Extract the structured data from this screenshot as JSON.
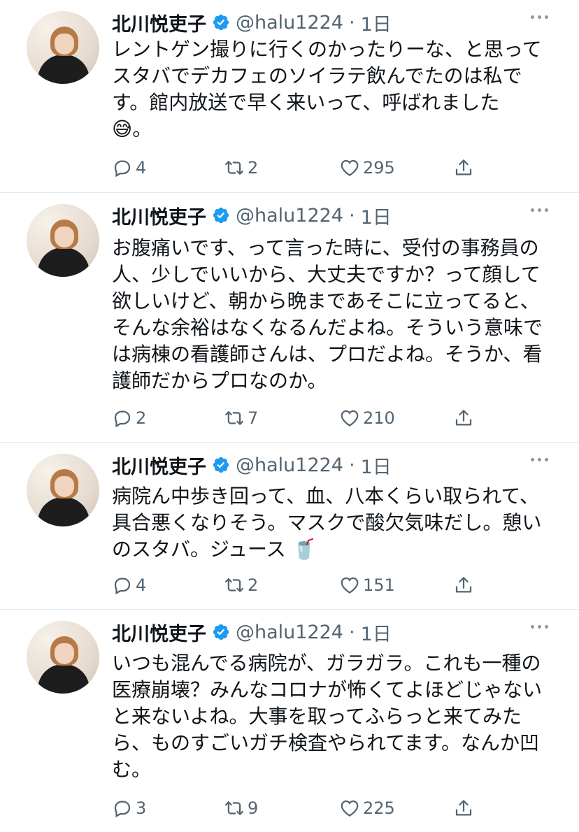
{
  "tweets": [
    {
      "name": "北川悦吏子",
      "handle": "@halu1224",
      "dot": "·",
      "time": "1日",
      "text": "レントゲン撮りに行くのかったりーな、と思って\nスタバでデカフェのソイラテ飲んでたのは私で\nす。館内放送で早く来いって、呼ばれました\n😅。",
      "replies": "4",
      "retweets": "2",
      "likes": "295"
    },
    {
      "name": "北川悦吏子",
      "handle": "@halu1224",
      "dot": "·",
      "time": "1日",
      "text": "お腹痛いです、って言った時に、受付の事務員の\n人、少しでいいから、大丈夫ですか？って顔して\n欲しいけど、朝から晩まであそこに立ってると、\nそんな余裕はなくなるんだよね。そういう意味で\nは病棟の看護師さんは、プロだよね。そうか、看\n護師だからプロなのか。",
      "replies": "2",
      "retweets": "7",
      "likes": "210"
    },
    {
      "name": "北川悦吏子",
      "handle": "@halu1224",
      "dot": "·",
      "time": "1日",
      "text": "病院ん中歩き回って、血、八本くらい取られて、\n具合悪くなりそう。マスクで酸欠気味だし。憩い\nのスタバ。ジュース 🥤",
      "replies": "4",
      "retweets": "2",
      "likes": "151"
    },
    {
      "name": "北川悦吏子",
      "handle": "@halu1224",
      "dot": "·",
      "time": "1日",
      "text": "いつも混んでる病院が、ガラガラ。これも一種の\n医療崩壊？みんなコロナが怖くてよほどじゃない\nと来ないよね。大事を取ってふらっと来てみた\nら、ものすごいガチ検査やられてます。なんか凹\nむ。",
      "replies": "3",
      "retweets": "9",
      "likes": "225"
    }
  ],
  "colors": {
    "text": "#0f1419",
    "secondary": "#536471",
    "verified": "#1d9bf0",
    "divider": "#e3e6e8"
  },
  "icons": [
    "verified-badge-icon",
    "more-icon",
    "reply-icon",
    "retweet-icon",
    "like-icon",
    "share-icon"
  ]
}
